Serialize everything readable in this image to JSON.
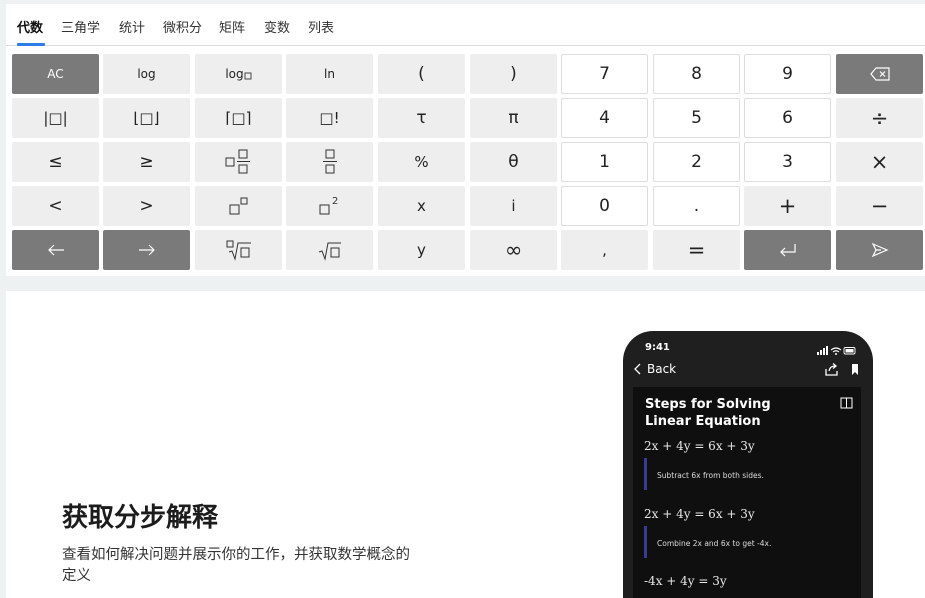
{
  "tabs": [
    "代数",
    "三角学",
    "统计",
    "微积分",
    "矩阵",
    "变数",
    "列表"
  ],
  "keys": {
    "ac": "AC",
    "log": "log",
    "log_base": "log",
    "ln": "ln",
    "lparen": "(",
    "rparen": ")",
    "d7": "7",
    "d8": "8",
    "d9": "9",
    "abs": "|□|",
    "floor": "⌊□⌋",
    "ceil": "⌈□⌉",
    "factorial": "□!",
    "tau": "τ",
    "pi": "π",
    "d4": "4",
    "d5": "5",
    "d6": "6",
    "divide": "÷",
    "le": "≤",
    "ge": "≥",
    "percent": "%",
    "theta": "θ",
    "d1": "1",
    "d2": "2",
    "d3": "3",
    "times": "×",
    "lt": "<",
    "gt": ">",
    "x": "x",
    "i": "i",
    "d0": "0",
    "dot": ".",
    "plus": "+",
    "minus": "−",
    "y": "y",
    "infinity": "∞",
    "comma": ",",
    "equals": "="
  },
  "promo": {
    "title": "获取分步解释",
    "description": "查看如何解决问题并展示你的工作，并获取数学概念的定义"
  },
  "phone": {
    "time": "9:41",
    "back": "Back",
    "title": "Steps for Solving Linear Equation",
    "eq1": "2x + 4y = 6x + 3y",
    "note1": "Subtract 6x from both sides.",
    "eq2": "2x + 4y = 6x + 3y",
    "note2": "Combine 2x and 6x to get -4x.",
    "eq3": "-4x + 4y = 3y"
  }
}
